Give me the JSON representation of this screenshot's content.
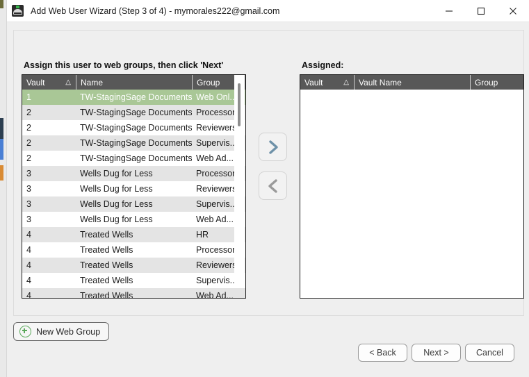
{
  "window": {
    "title": "Add Web User Wizard (Step 3 of 4) - mymorales222@gmail.com",
    "app_icon": "vault-app-icon",
    "controls": {
      "minimize": "minimize-icon",
      "maximize": "maximize-icon",
      "close": "close-icon"
    }
  },
  "left_panel": {
    "label": "Assign this user to web groups, then click 'Next'",
    "columns": [
      "Vault",
      "Name",
      "Group"
    ],
    "sort_indicator": "△",
    "rows": [
      {
        "vault": "1",
        "name": "TW-StagingSage Documents",
        "group": "Web Onl...",
        "selected": true
      },
      {
        "vault": "2",
        "name": "TW-StagingSage Documents Test",
        "group": "Processors",
        "selected": false
      },
      {
        "vault": "2",
        "name": "TW-StagingSage Documents Test",
        "group": "Reviewers",
        "selected": false
      },
      {
        "vault": "2",
        "name": "TW-StagingSage Documents Test",
        "group": "Supervis...",
        "selected": false
      },
      {
        "vault": "2",
        "name": "TW-StagingSage Documents Test",
        "group": "Web Ad...",
        "selected": false
      },
      {
        "vault": "3",
        "name": "Wells Dug for Less",
        "group": "Processors",
        "selected": false
      },
      {
        "vault": "3",
        "name": "Wells Dug for Less",
        "group": "Reviewers",
        "selected": false
      },
      {
        "vault": "3",
        "name": "Wells Dug for Less",
        "group": "Supervis...",
        "selected": false
      },
      {
        "vault": "3",
        "name": "Wells Dug for Less",
        "group": "Web Ad...",
        "selected": false
      },
      {
        "vault": "4",
        "name": "Treated Wells",
        "group": "HR",
        "selected": false
      },
      {
        "vault": "4",
        "name": "Treated Wells",
        "group": "Processors",
        "selected": false
      },
      {
        "vault": "4",
        "name": "Treated Wells",
        "group": "Reviewers",
        "selected": false
      },
      {
        "vault": "4",
        "name": "Treated Wells",
        "group": "Supervis...",
        "selected": false
      },
      {
        "vault": "4",
        "name": "Treated Wells",
        "group": "Web Ad...",
        "selected": false
      }
    ]
  },
  "right_panel": {
    "label": "Assigned:",
    "columns": [
      "Vault",
      "Vault Name",
      "Group"
    ],
    "sort_indicator": "△",
    "rows": []
  },
  "transfer": {
    "add_icon": "chevron-right-icon",
    "remove_icon": "chevron-left-icon"
  },
  "actions": {
    "new_web_group": "New Web Group",
    "back": "< Back",
    "next": "Next >",
    "cancel": "Cancel"
  },
  "colors": {
    "selection_green": "#a9c796",
    "header_gray": "#585858",
    "alt_row": "#e4e4e4",
    "accent_blue": "#6e91a8",
    "accent_green": "#5aa95a"
  }
}
